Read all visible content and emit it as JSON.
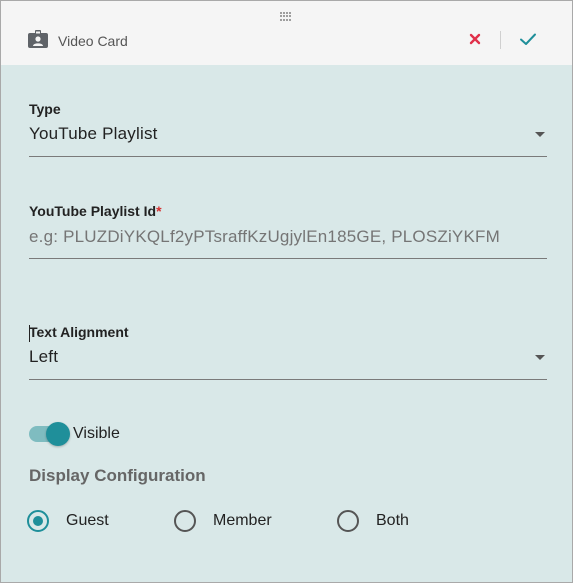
{
  "header": {
    "title": "Video Card",
    "icons": {
      "drag": "drag-handle-icon",
      "card": "badge-icon",
      "close": "close-icon",
      "confirm": "check-icon"
    },
    "colors": {
      "close": "#e0304a",
      "confirm": "#1f8f9a"
    }
  },
  "form": {
    "type": {
      "label": "Type",
      "value": "YouTube Playlist"
    },
    "playlist_id": {
      "label": "YouTube Playlist Id",
      "required_mark": "*",
      "value": "",
      "placeholder": "e.g: PLUZDiYKQLf2yPTsraffKzUgjylEn185GE, PLOSZiYKFM"
    },
    "text_alignment": {
      "label": "Text Alignment",
      "value": "Left"
    },
    "visible": {
      "label": "Visible",
      "checked": true
    },
    "display_configuration": {
      "title": "Display Configuration",
      "options": [
        {
          "label": "Guest",
          "selected": true
        },
        {
          "label": "Member",
          "selected": false
        },
        {
          "label": "Both",
          "selected": false
        }
      ]
    }
  },
  "colors": {
    "accent": "#1f8f9a",
    "panel_background": "#d9e8e8",
    "header_background": "#f5f5f5",
    "required": "#d32f2f"
  }
}
